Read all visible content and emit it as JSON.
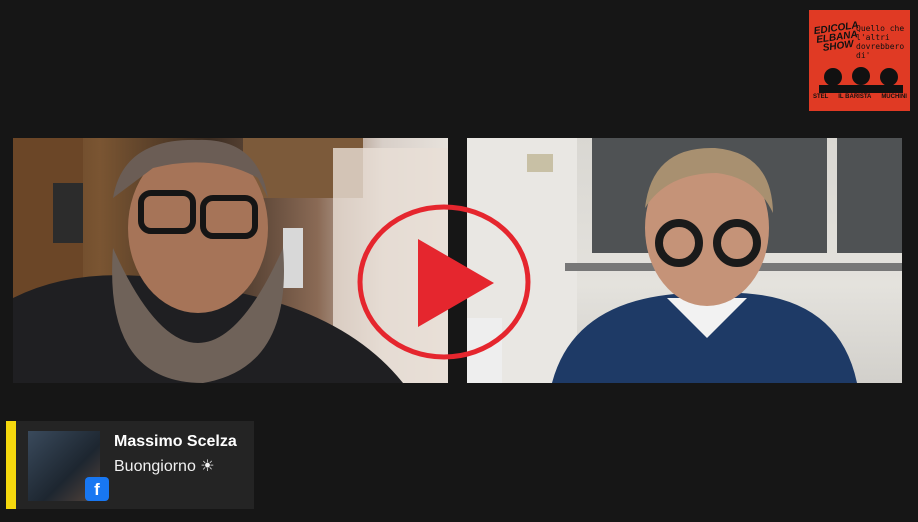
{
  "logo": {
    "title": "EDICOLA ELBANA SHOW",
    "tagline": "Quello che l'altri dovrebbero di'",
    "hosts": [
      "STEL",
      "IL BARISTA",
      "MUCHINI"
    ]
  },
  "comment": {
    "author": "Massimo Scelza",
    "message": "Buongiorno ☀",
    "platform_icon": "facebook-icon"
  },
  "play_button": {
    "icon": "play-icon",
    "color": "#e5262e"
  },
  "colors": {
    "accent_bar": "#f5d80e",
    "logo_bg": "#e03a24",
    "facebook": "#1877f2"
  }
}
